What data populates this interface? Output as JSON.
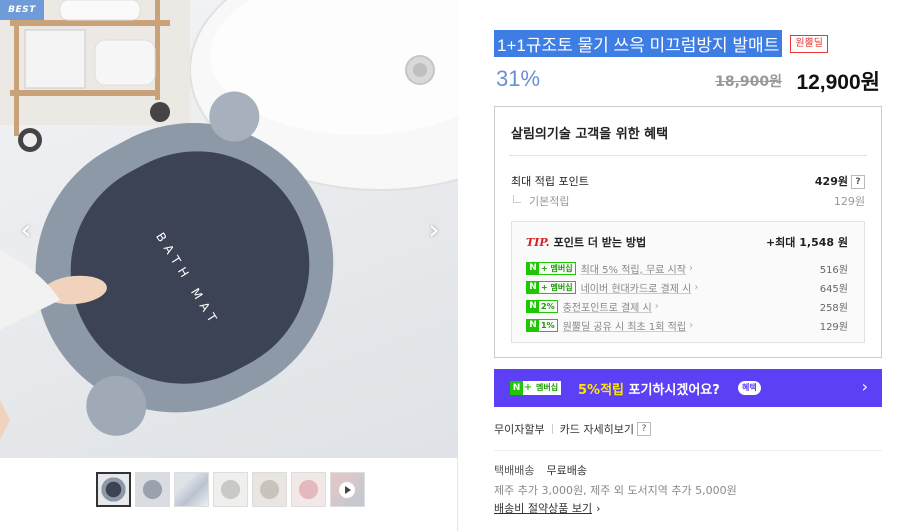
{
  "gallery": {
    "best_badge": "BEST",
    "mat_text": "BATH MAT",
    "thumb_count": 7,
    "active_thumb": 0
  },
  "product": {
    "title": "1+1규조토 물기 쓰윽 미끄럼방지 발매트",
    "origin_badge": "원뿔딜",
    "discount": "31%",
    "original_price": "18,900원",
    "sale_price": "12,900원"
  },
  "benefits": {
    "title": "살림의기술 고객을 위한 혜택",
    "max_points_label": "최대 적립 포인트",
    "max_points_value": "429원",
    "basic_label": "기본적립",
    "basic_value": "129원",
    "tip": {
      "label": "TIP.",
      "heading": "포인트 더 받는 방법",
      "max": "+최대 1,548 원",
      "items": [
        {
          "badge": "+ 멤버십",
          "text": "최대 5% 적립, 무료 시작",
          "value": "516원"
        },
        {
          "badge": "+ 멤버십",
          "text": "네이버 현대카드로 결제 시",
          "value": "645원"
        },
        {
          "badge": "2%",
          "text": "충전포인트로 결제 시",
          "value": "258원"
        },
        {
          "badge": "1%",
          "text": "원뿔딜 공유 시 최초 1회 적립",
          "value": "129원"
        }
      ]
    }
  },
  "banner": {
    "badge_plus": "+",
    "badge_text": "멤버십",
    "highlight": "5%적립",
    "text": " 포기하시겠어요?",
    "pill": "혜택"
  },
  "installment": {
    "label": "무이자할부",
    "card_link": "카드 자세히보기",
    "q": "?"
  },
  "shipping": {
    "label": "택배배송",
    "value": "무료배송",
    "extra": "제주 추가 3,000원, 제주 외 도서지역 추가 5,000원",
    "link": "배송비 절약상품 보기"
  },
  "colors": {
    "accent_blue": "#3e7de4",
    "naver_green": "#1ec800",
    "banner_purple": "#5b40f5",
    "discount": "#6b8fcf"
  }
}
